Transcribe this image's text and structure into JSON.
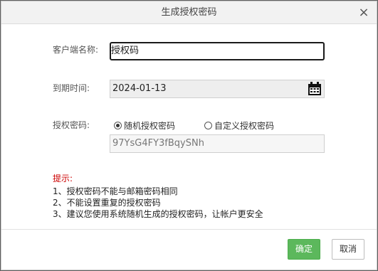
{
  "dialog": {
    "title": "生成授权密码",
    "close_glyph": "×",
    "fields": {
      "client_name": {
        "label": "客户端名称:",
        "value": "授权码"
      },
      "expiry": {
        "label": "到期时间:",
        "value": "2024-01-13",
        "icon": "calendar-icon"
      },
      "password": {
        "label": "授权密码:",
        "options": [
          "随机授权密码",
          "自定义授权密码"
        ],
        "selected": "随机授权密码",
        "value": "97YsG4FY3fBqySNh"
      }
    },
    "tips": {
      "title": "提示:",
      "items": [
        "1、授权密码不能与邮箱密码相同",
        "2、不能设置重复的授权密码",
        "3、建议您使用系统随机生成的授权密码，让帐户更安全"
      ]
    },
    "buttons": {
      "ok": "确定",
      "cancel": "取消"
    },
    "colors": {
      "ok_button": "#5cb85c",
      "tips_title": "#cc0000"
    }
  }
}
